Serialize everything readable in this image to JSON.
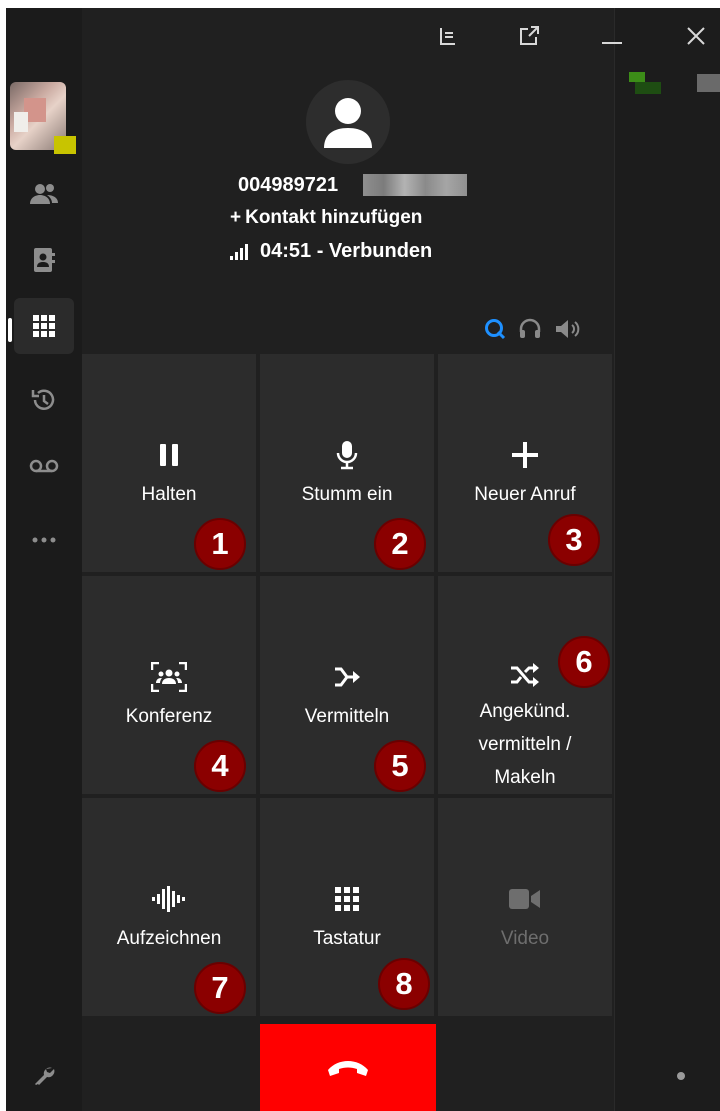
{
  "caller": {
    "number_visible": "004989721",
    "add_contact": "Kontakt hinzufügen",
    "call_status": "04:51 - Verbunden"
  },
  "actions": [
    {
      "label": "Halten",
      "icon": "pause-icon",
      "badge": "1",
      "enabled": true
    },
    {
      "label": "Stumm ein",
      "icon": "microphone-icon",
      "badge": "2",
      "enabled": true
    },
    {
      "label": "Neuer Anruf",
      "icon": "plus-icon",
      "badge": "3",
      "enabled": true
    },
    {
      "label": "Konferenz",
      "icon": "conference-icon",
      "badge": "4",
      "enabled": true
    },
    {
      "label": "Vermitteln",
      "icon": "transfer-icon",
      "badge": "5",
      "enabled": true
    },
    {
      "label": "Angekünd.",
      "label_line2": "vermitteln /",
      "label_line3": "Makeln",
      "icon": "shuffle-icon",
      "badge": "6",
      "enabled": true
    },
    {
      "label": "Aufzeichnen",
      "icon": "waveform-icon",
      "badge": "7",
      "enabled": true
    },
    {
      "label": "Tastatur",
      "icon": "keypad-icon",
      "badge": "8",
      "enabled": true
    },
    {
      "label": "Video",
      "icon": "video-icon",
      "badge": "",
      "enabled": false
    }
  ],
  "colors": {
    "hangup": "#ff0000",
    "badge": "#8b0000",
    "accent_blue": "#1e90ff",
    "presence": "#c8c400"
  },
  "sidebar": {
    "items": [
      "contacts-icon",
      "address-book-icon",
      "dialpad-icon",
      "history-icon",
      "voicemail-icon",
      "more-icon"
    ],
    "active": "dialpad-icon",
    "bottom": "settings-wrench-icon"
  },
  "titlebar": {
    "buttons": [
      "panel-icon",
      "popout-icon",
      "minimize-icon",
      "close-icon"
    ]
  }
}
